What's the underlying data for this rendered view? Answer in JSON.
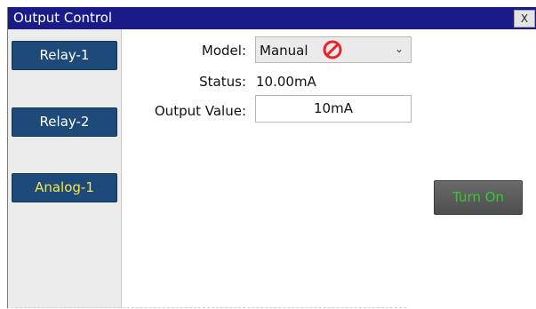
{
  "window": {
    "title": "Output Control",
    "close_label": "X"
  },
  "sidebar": {
    "items": [
      {
        "label": "Relay-1",
        "active": false
      },
      {
        "label": "Relay-2",
        "active": false
      },
      {
        "label": "Analog-1",
        "active": true
      }
    ]
  },
  "form": {
    "model_label": "Model:",
    "model_value": "Manual",
    "model_icon": "no-entry-icon",
    "status_label": "Status:",
    "status_value": "10.00mA",
    "output_label": "Output Value:",
    "output_value": "10mA"
  },
  "actions": {
    "turn_on_label": "Turn On"
  },
  "colors": {
    "titlebar": "#1a1a88",
    "nav_button": "#1e4a79",
    "active_text": "#f3e64a",
    "turn_on_text": "#25d425",
    "no_icon": "#e8232a"
  }
}
